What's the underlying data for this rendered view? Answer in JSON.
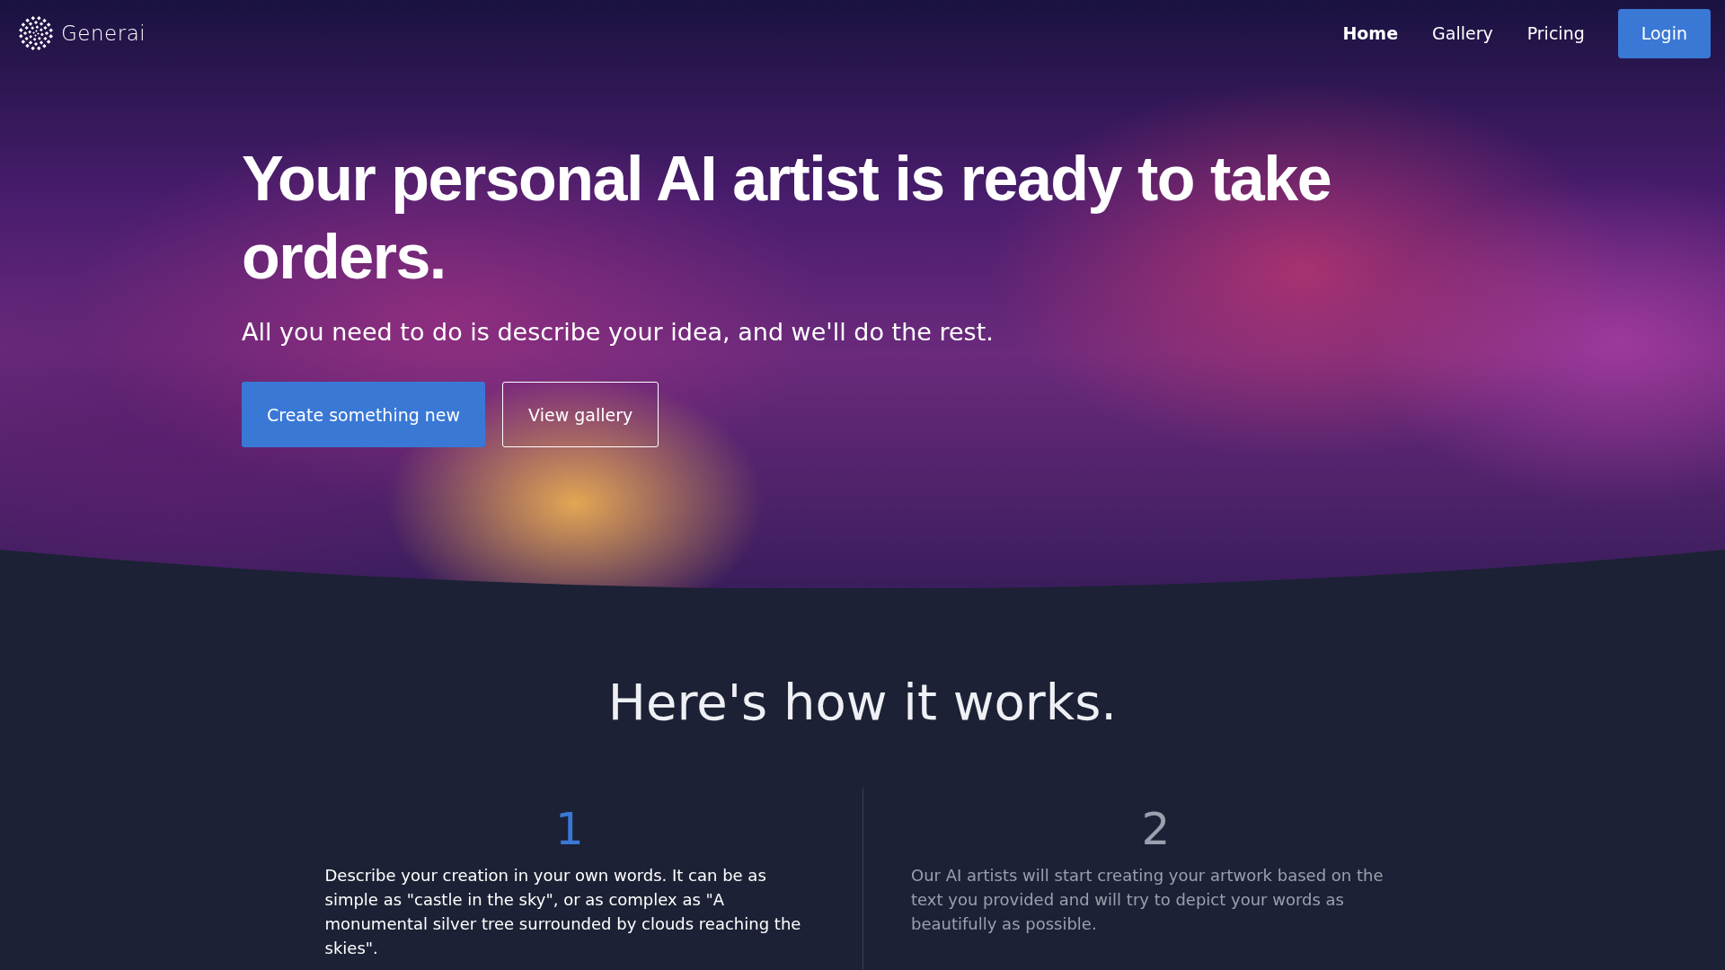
{
  "nav": {
    "brand": "Generai",
    "links": [
      {
        "label": "Home",
        "selected": true
      },
      {
        "label": "Gallery",
        "selected": false
      },
      {
        "label": "Pricing",
        "selected": false
      }
    ],
    "login": "Login"
  },
  "hero": {
    "title": "Your personal AI artist is ready to take orders.",
    "subtitle": "All you need to do is describe your idea, and we'll do the rest.",
    "buttons": [
      {
        "label": "Create something new",
        "kind": "primary"
      },
      {
        "label": "View gallery",
        "kind": "outline"
      }
    ]
  },
  "how_it_works": {
    "title": "Here's how it works.",
    "steps": [
      {
        "number": "1",
        "text": "Describe your creation in your own words. It can be as simple as \"castle in the sky\", or as complex as \"A monumental silver tree surrounded by clouds reaching the skies\".",
        "selected": true
      },
      {
        "number": "2",
        "text": "Our AI artists will start creating your artwork based on the text you provided and will try to depict your words as beautifully as possible.",
        "selected": false
      }
    ]
  }
}
